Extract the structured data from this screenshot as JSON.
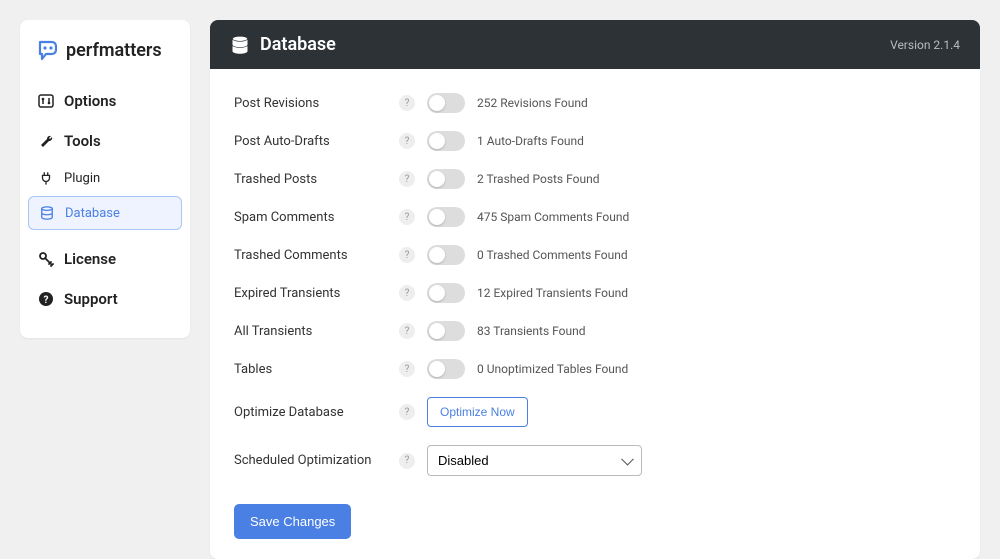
{
  "brand": "perfmatters",
  "sidebar": {
    "items": [
      {
        "label": "Options"
      },
      {
        "label": "Tools"
      },
      {
        "label": "Plugin"
      },
      {
        "label": "Database"
      },
      {
        "label": "License"
      },
      {
        "label": "Support"
      }
    ]
  },
  "header": {
    "title": "Database",
    "version": "Version 2.1.4"
  },
  "rows": [
    {
      "label": "Post Revisions",
      "status": "252 Revisions Found"
    },
    {
      "label": "Post Auto-Drafts",
      "status": "1 Auto-Drafts Found"
    },
    {
      "label": "Trashed Posts",
      "status": "2 Trashed Posts Found"
    },
    {
      "label": "Spam Comments",
      "status": "475 Spam Comments Found"
    },
    {
      "label": "Trashed Comments",
      "status": "0 Trashed Comments Found"
    },
    {
      "label": "Expired Transients",
      "status": "12 Expired Transients Found"
    },
    {
      "label": "All Transients",
      "status": "83 Transients Found"
    },
    {
      "label": "Tables",
      "status": "0 Unoptimized Tables Found"
    }
  ],
  "optimize": {
    "label": "Optimize Database",
    "button": "Optimize Now"
  },
  "schedule": {
    "label": "Scheduled Optimization",
    "value": "Disabled"
  },
  "save_button": "Save Changes",
  "help_char": "?"
}
